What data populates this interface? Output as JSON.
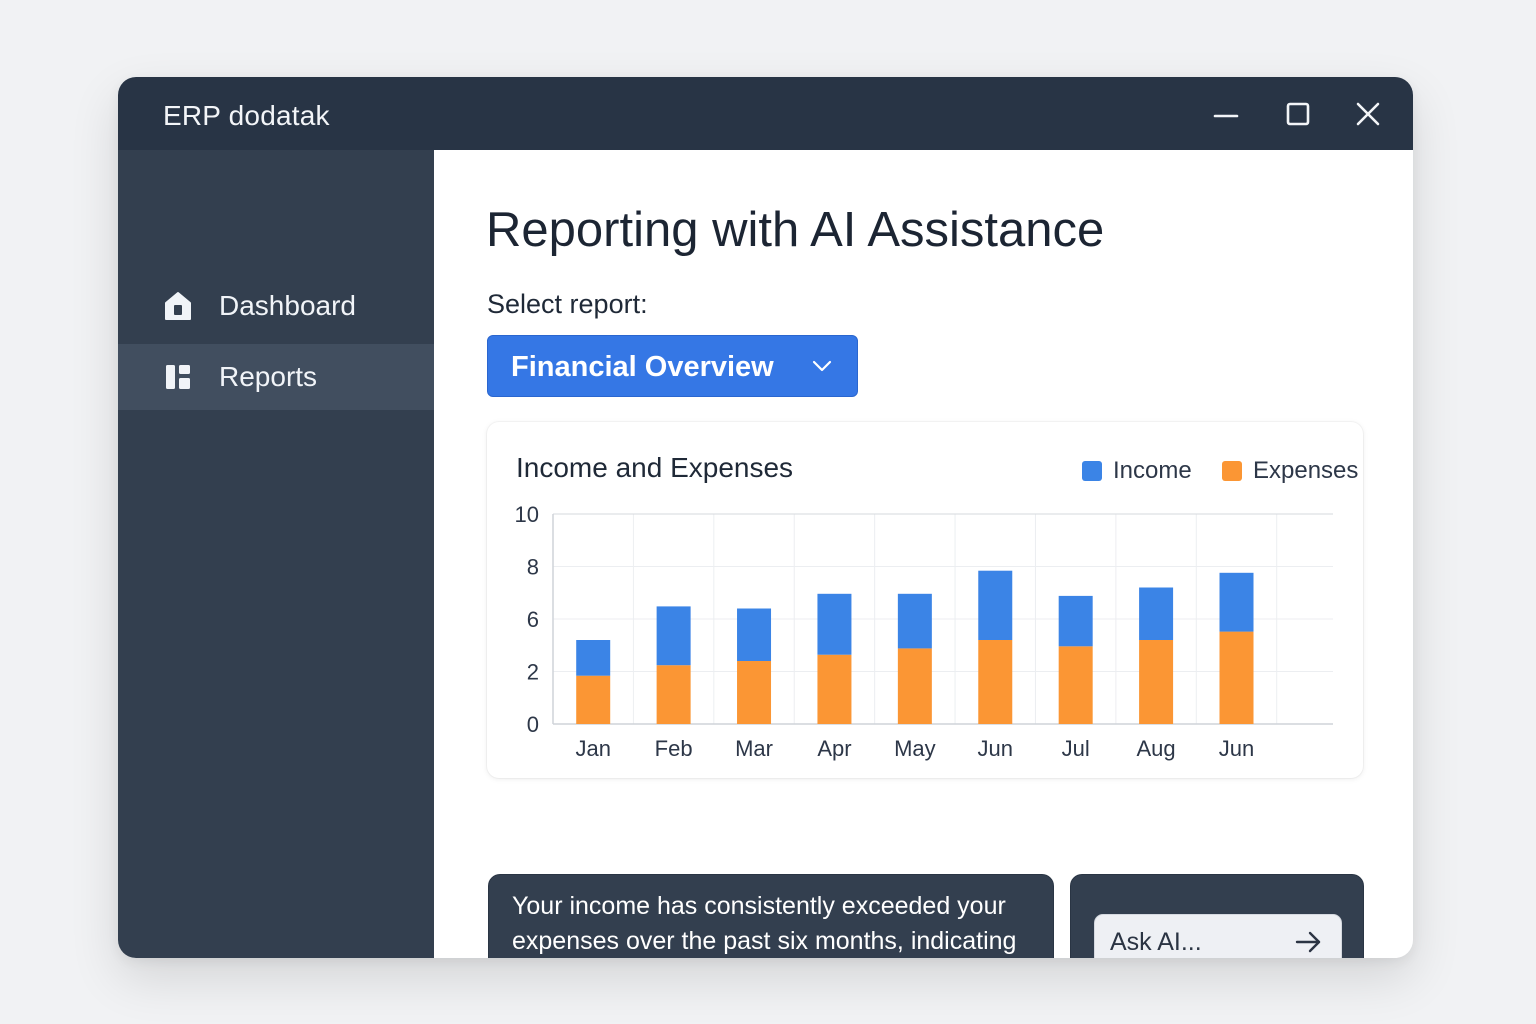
{
  "window": {
    "title": "ERP dodatak"
  },
  "sidebar": {
    "items": [
      {
        "label": "Dashboard",
        "icon": "home-icon",
        "active": false
      },
      {
        "label": "Reports",
        "icon": "reports-icon",
        "active": true
      }
    ]
  },
  "main": {
    "title": "Reporting with AI Assistance",
    "select_label": "Select report:",
    "selected_report": "Financial Overview"
  },
  "colors": {
    "accent": "#3577e5",
    "income": "#3b84e6",
    "expenses": "#fb9634",
    "sidebar": "#333f4f",
    "titlebar": "#283445"
  },
  "chart_data": {
    "type": "bar",
    "stacked": true,
    "title": "Income and Expenses",
    "legend_position": "top-right",
    "categories": [
      "Jan",
      "Feb",
      "Mar",
      "Apr",
      "May",
      "Jun",
      "Jul",
      "Aug",
      "Jun"
    ],
    "series": [
      {
        "name": "Income",
        "color": "#3b84e6",
        "values": [
          1.7,
          2.8,
          2.5,
          2.9,
          2.6,
          3.3,
          2.4,
          2.5,
          2.8
        ]
      },
      {
        "name": "Expenses",
        "color": "#fb9634",
        "values": [
          2.3,
          2.8,
          3.0,
          3.3,
          3.6,
          4.0,
          3.7,
          4.0,
          4.4
        ]
      }
    ],
    "y_ticks": [
      "0",
      "2",
      "6",
      "8",
      "10"
    ],
    "ylim": [
      0,
      10
    ],
    "grid": true
  },
  "insight": {
    "text": "Your income has consistently exceeded your expenses over the past six months, indicating a positive financial trend."
  },
  "ask": {
    "placeholder": "Ask AI..."
  }
}
